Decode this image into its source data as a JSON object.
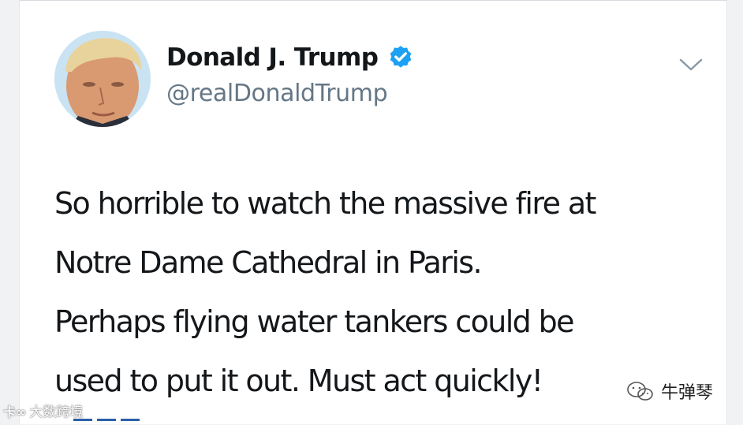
{
  "tweet": {
    "author": {
      "display_name": "Donald J. Trump",
      "handle": "@realDonaldTrump",
      "verified": true,
      "verified_badge_color": "#1da1f2",
      "avatar_icon": "profile-photo"
    },
    "menu_icon": "chevron-down-icon",
    "text_lines": [
      "So horrible to watch the massive fire at",
      "Notre Dame Cathedral in Paris.",
      "Perhaps flying water tankers could be",
      "used to put it out. Must act quickly!"
    ]
  },
  "watermarks": {
    "left": {
      "logo": "卡∞",
      "text": "大数跨境"
    },
    "right": {
      "icon": "wechat-icon",
      "text": "牛弹琴"
    }
  },
  "colors": {
    "text_primary": "#14171a",
    "text_secondary": "#657786",
    "background": "#ffffff",
    "verified_blue": "#1da1f2"
  }
}
